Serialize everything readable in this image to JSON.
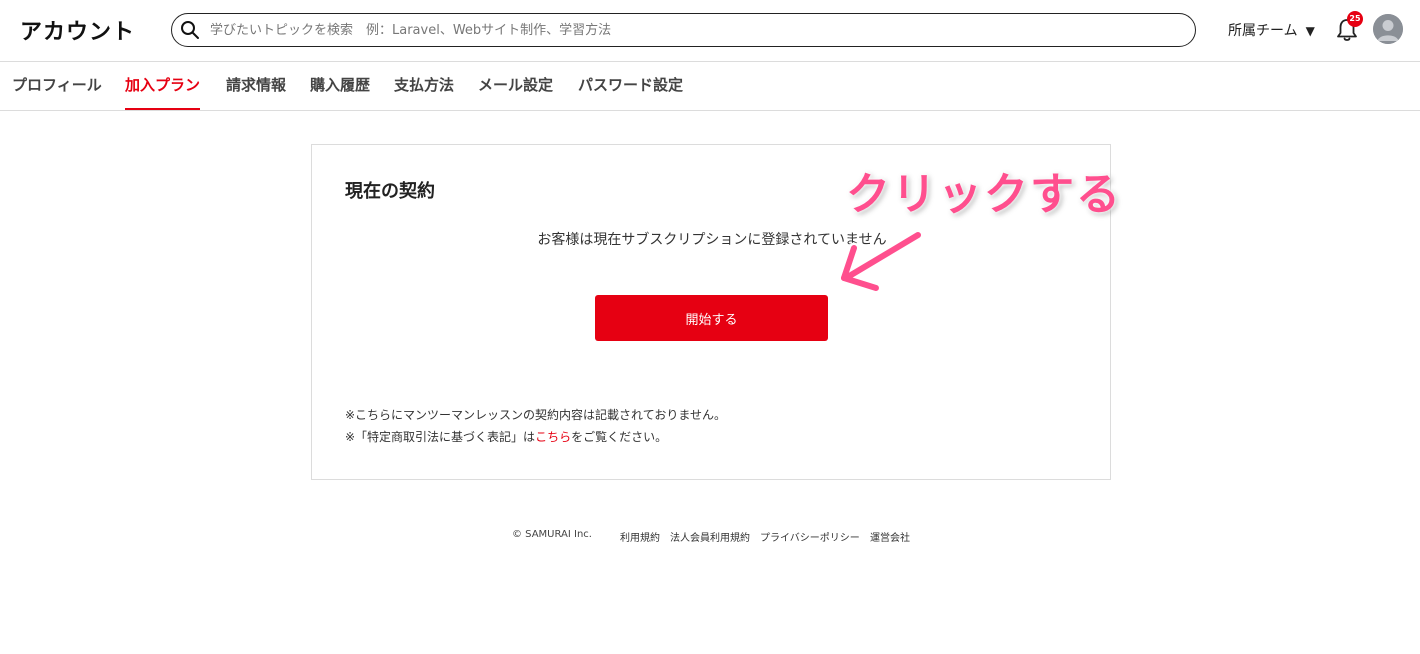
{
  "header": {
    "title": "アカウント",
    "search": {
      "placeholder": "学びたいトピックを検索　例：Laravel、Webサイト制作、学習方法",
      "value": ""
    },
    "team_select": {
      "label": "所属チーム"
    },
    "notifications": {
      "count": "25"
    },
    "icons": [
      "search-icon",
      "bell-icon",
      "avatar"
    ]
  },
  "tabs": [
    {
      "label": "プロフィール",
      "active": false
    },
    {
      "label": "加入プラン",
      "active": true
    },
    {
      "label": "請求情報",
      "active": false
    },
    {
      "label": "購入履歴",
      "active": false
    },
    {
      "label": "支払方法",
      "active": false
    },
    {
      "label": "メール設定",
      "active": false
    },
    {
      "label": "パスワード設定",
      "active": false
    }
  ],
  "contract": {
    "title": "現在の契約",
    "message": "お客様は現在サブスクリプションに登録されていません",
    "start_button": "開始する",
    "note1": "※こちらにマンツーマンレッスンの契約内容は記載されておりません。",
    "note2_prefix": "※「特定商取引法に基づく表記」は",
    "note2_link": "こちら",
    "note2_suffix": "をご覧ください。"
  },
  "annotation": {
    "text": "クリックする"
  },
  "footer": {
    "copyright": "© SAMURAI Inc.",
    "links": [
      "利用規約",
      "法人会員利用規約",
      "プライバシーポリシー",
      "運営会社"
    ]
  },
  "colors": {
    "accent": "#e60012",
    "annotation": "#ff4f8e",
    "border": "#dcdcdc"
  }
}
